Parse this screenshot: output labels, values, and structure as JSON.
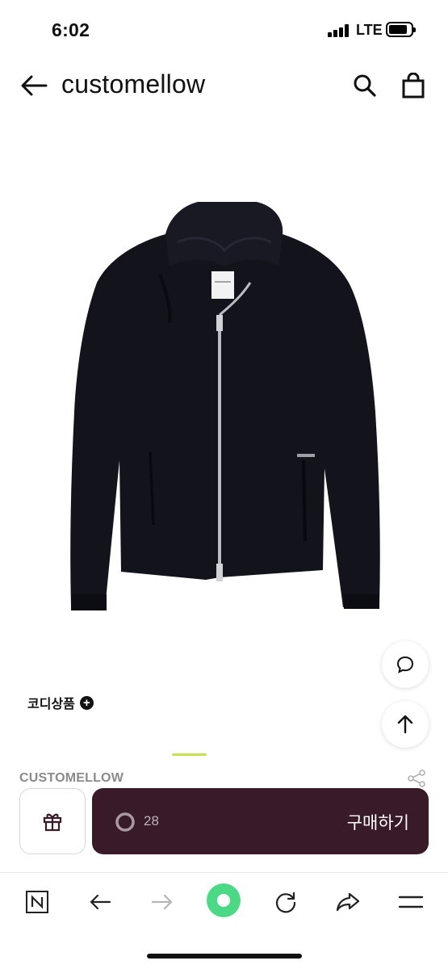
{
  "status_bar": {
    "time": "6:02",
    "network": "LTE"
  },
  "header": {
    "brand": "customellow",
    "back_icon": "arrow-left-icon",
    "search_icon": "search-icon",
    "bag_icon": "shopping-bag-icon"
  },
  "product": {
    "image_icon": "black-zip-jacket-image",
    "codi_label": "코디상품",
    "brand_name": "CUSTOMELLOW"
  },
  "floating": {
    "chat_icon": "chat-bubble-icon",
    "top_icon": "arrow-up-icon"
  },
  "purchase_bar": {
    "gift_icon": "gift-icon",
    "like_count": "28",
    "buy_label": "구매하기"
  },
  "toolbar": {
    "items": [
      "naver-n-icon",
      "back-arrow-icon",
      "forward-arrow-icon",
      "green-dot-icon",
      "refresh-icon",
      "share-arrow-icon",
      "menu-icon"
    ]
  },
  "colors": {
    "buy_button_bg": "#381a28",
    "indicator": "#c5e04a",
    "green_button": "#4cd986"
  }
}
